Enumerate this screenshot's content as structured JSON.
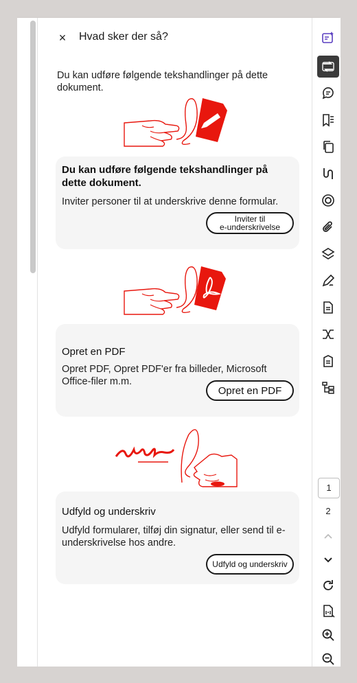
{
  "panel": {
    "close_label": "×",
    "title": "Hvad sker der så?",
    "intro": "Du kan udføre følgende tekshandlinger på dette dokument."
  },
  "cards": [
    {
      "heading": "Du kan udføre følgende tekshandlinger på dette dokument.",
      "text": "Inviter personer til at underskrive denne formular.",
      "button_line1": "Inviter til",
      "button_line2": "e-underskrivelse"
    },
    {
      "heading": "Opret en PDF",
      "text": "Opret PDF, Opret PDF'er fra billeder, Microsoft Office-filer m.m.",
      "button": "Opret en PDF"
    },
    {
      "heading": "Udfyld og underskriv",
      "text": "Udfyld formularer, tilføj din signatur, eller send til e-underskrivelse hos andre.",
      "button": "Udfyld og underskriv"
    }
  ],
  "pages": {
    "current": "1",
    "next": "2"
  },
  "colors": {
    "accent_red": "#e8170e",
    "brand_purple": "#5a3fc0",
    "active_tool_bg": "#3b3b3b"
  },
  "toolbar_icons": [
    "ai-assistant-icon",
    "convert-icon",
    "comment-icon",
    "bookmark-icon",
    "pages-icon",
    "compare-icon",
    "redact-icon",
    "attachment-icon",
    "layers-icon",
    "sign-icon",
    "document-icon",
    "workflow-icon",
    "forms-icon",
    "tree-icon",
    "rotate-icon",
    "fit-page-icon",
    "zoom-in-icon",
    "zoom-out-icon"
  ]
}
